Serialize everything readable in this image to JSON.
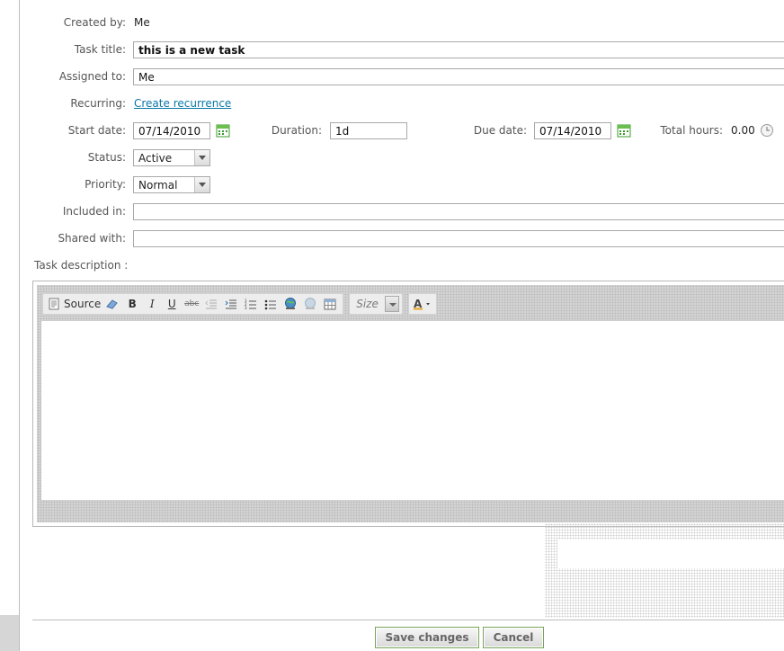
{
  "form": {
    "created_by_label": "Created by:",
    "created_by_value": "Me",
    "task_title_label": "Task title:",
    "task_title_value": "this is a new task",
    "assigned_to_label": "Assigned to:",
    "assigned_to_value": "Me",
    "recurring_label": "Recurring:",
    "recurring_link": "Create recurrence",
    "start_date_label": "Start date:",
    "start_date_value": "07/14/2010",
    "duration_label": "Duration:",
    "duration_value": "1d",
    "due_date_label": "Due date:",
    "due_date_value": "07/14/2010",
    "total_hours_label": "Total hours:",
    "total_hours_value": "0.00",
    "status_label": "Status:",
    "status_value": "Active",
    "priority_label": "Priority:",
    "priority_value": "Normal",
    "included_in_label": "Included in:",
    "included_in_value": "",
    "shared_with_label": "Shared with:",
    "shared_with_value": "",
    "description_label": "Task description :"
  },
  "editor": {
    "source_label": "Source",
    "size_label": "Size",
    "tools": [
      "source-icon",
      "eraser-icon",
      "bold-icon",
      "italic-icon",
      "underline-icon",
      "strikethrough-icon",
      "outdent-icon",
      "indent-icon",
      "numbered-list-icon",
      "bulleted-list-icon",
      "link-icon",
      "unlink-icon",
      "table-icon",
      "font-color-icon"
    ]
  },
  "actions": {
    "save_label": "Save changes",
    "cancel_label": "Cancel"
  },
  "colors": {
    "link": "#0a77a8",
    "button_border": "#7aa35a",
    "calendar_icon": "#3c9a2e"
  }
}
